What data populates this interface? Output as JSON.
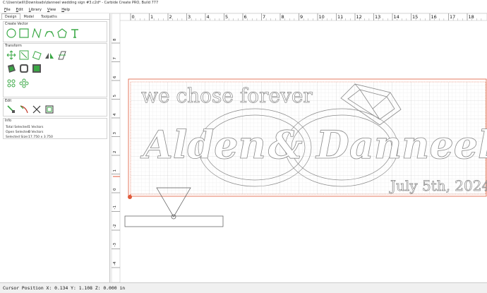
{
  "window": {
    "title": "C:\\Users\\will\\Downloads\\danneel wedding sign #3.c2d* - Carbide Create PRO, Build 777"
  },
  "menu": [
    {
      "pre": "",
      "u": "F",
      "post": "ile"
    },
    {
      "pre": "",
      "u": "E",
      "post": "dit"
    },
    {
      "pre": "",
      "u": "L",
      "post": "ibrary"
    },
    {
      "pre": "",
      "u": "V",
      "post": "iew"
    },
    {
      "pre": "",
      "u": "H",
      "post": "elp"
    }
  ],
  "tabs": [
    "Design",
    "Model",
    "Toolpaths"
  ],
  "active_tab": "Design",
  "sections": {
    "create_vector": "Create Vector",
    "transform": "Transform",
    "edit": "Edit",
    "info": "Info"
  },
  "info": {
    "rows": [
      {
        "label": "Total Selected:",
        "value": "1 Vectors"
      },
      {
        "label": "Open Selected:",
        "value": "0 Vectors"
      },
      {
        "label": "Selected Size:",
        "value": "17.750 x 3.750"
      }
    ]
  },
  "ruler": {
    "x_labels": [
      "0",
      "1",
      "2",
      "3",
      "4",
      "5",
      "6",
      "7",
      "8",
      "9",
      "10",
      "11",
      "12",
      "13",
      "14",
      "15",
      "16",
      "17",
      "18"
    ],
    "y_labels": [
      "8",
      "7",
      "6",
      "5",
      "4",
      "3",
      "2",
      "1",
      "0",
      "-1",
      "-2",
      "-3",
      "-4"
    ]
  },
  "canvas": {
    "line1": "we chose forever",
    "line2a": "Alden",
    "amp": "&",
    "line2b": "Danneel",
    "date": "July 5th, 2024"
  },
  "status": {
    "text": "Cursor Position X: 0.134 Y: 1.108 Z: 0.000 in"
  },
  "colors": {
    "accent_green": "#3aa845",
    "stock_outline": "#e05a3a",
    "vector": "#8a8a8a",
    "grid": "#dcdcdc"
  }
}
